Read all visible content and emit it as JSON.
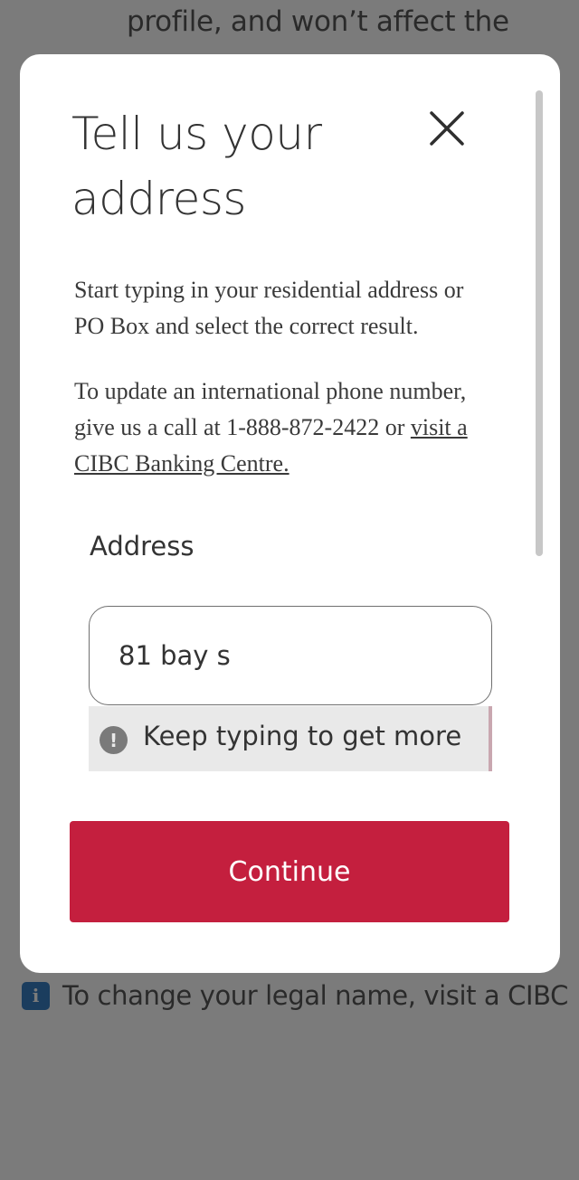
{
  "background": {
    "top_text": "profile, and won’t affect the",
    "info_icon": "i",
    "info_text": "To change your legal name, visit a CIBC"
  },
  "modal": {
    "title": "Tell us your address",
    "close_icon": "close-icon",
    "para1": "Start typing in your residential address or PO Box and select the correct result.",
    "para2_text": "To update an international phone number, give us a call at 1-888-872-2422 or ",
    "para2_link": "visit a CIBC Banking Centre.",
    "address_label": "Address",
    "address_value": "81 bay s",
    "suggestion_icon": "!",
    "suggestion_text": "Keep typing to get more",
    "continue_label": "Continue"
  },
  "colors": {
    "overlay": "#7b7b7b",
    "brand_red": "#c41f3e",
    "info_blue": "#1b3d5e"
  }
}
